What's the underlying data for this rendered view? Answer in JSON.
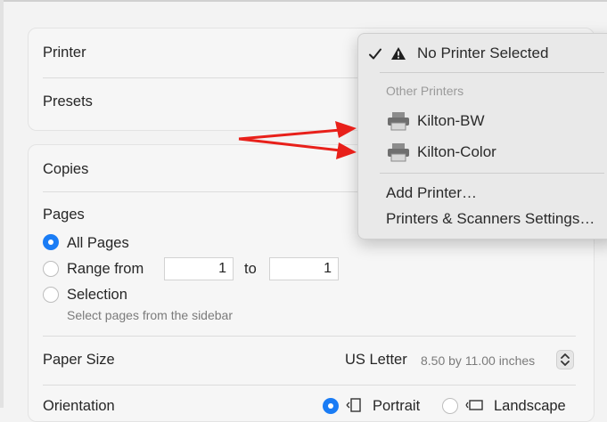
{
  "settings": {
    "printer_label": "Printer",
    "presets_label": "Presets",
    "copies_label": "Copies",
    "pages_label": "Pages",
    "pages_options": {
      "all": "All Pages",
      "range": "Range from",
      "range_to": "to",
      "range_from_value": "1",
      "range_to_value": "1",
      "selection": "Selection",
      "selection_hint": "Select pages from the sidebar"
    },
    "paper_size_label": "Paper Size",
    "paper_size_value": "US Letter",
    "paper_size_detail": "8.50 by 11.00 inches",
    "orientation_label": "Orientation",
    "orientation_portrait": "Portrait",
    "orientation_landscape": "Landscape"
  },
  "printer_menu": {
    "selected": "No Printer Selected",
    "section_header": "Other Printers",
    "printers": [
      "Kilton-BW",
      "Kilton-Color"
    ],
    "actions": [
      "Add Printer…",
      "Printers & Scanners Settings…"
    ]
  },
  "colors": {
    "accent": "#1a7cf5",
    "annotation_arrow": "#e8201a"
  },
  "icons": {
    "check": "checkmark-icon",
    "warning": "warning-triangle-icon",
    "printer": "printer-icon",
    "stepper": "up-down-chevron-icon",
    "portrait": "portrait-orientation-icon",
    "landscape": "landscape-orientation-icon"
  }
}
